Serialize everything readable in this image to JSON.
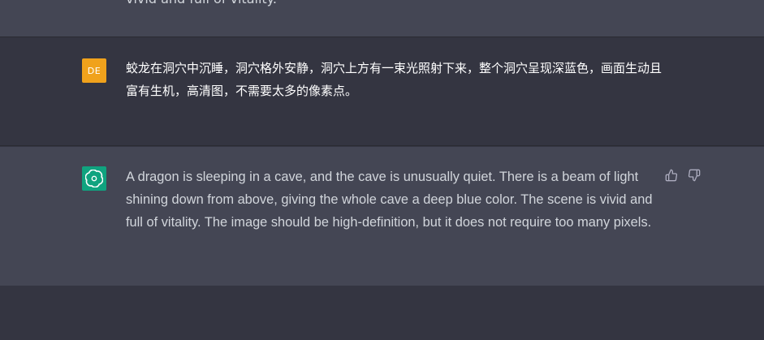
{
  "conversation": {
    "previous_message_tail": "vivid and full of vitality.",
    "user_message": {
      "avatar_initials": "DE",
      "avatar_color": "#f0a21c",
      "text": "蛟龙在洞穴中沉睡，洞穴格外安静，洞穴上方有一束光照射下来，整个洞穴呈现深蓝色，画面生动且富有生机，高清图，不需要太多的像素点。"
    },
    "assistant_message": {
      "avatar_icon": "openai-logo-icon",
      "avatar_color": "#10a37f",
      "text": "A dragon is sleeping in a cave, and the cave is unusually quiet. There is a beam of light shining down from above, giving the whole cave a deep blue color. The scene is vivid and full of vitality. The image should be high-definition, but it does not require too many pixels.",
      "feedback": {
        "thumbs_up_icon": "thumbs-up-icon",
        "thumbs_down_icon": "thumbs-down-icon"
      }
    }
  },
  "colors": {
    "background_dark": "#343541",
    "background_assistant": "#444654",
    "text_primary": "#ececf1",
    "text_secondary": "#d1d5db",
    "icon_gray": "#acacbe"
  }
}
